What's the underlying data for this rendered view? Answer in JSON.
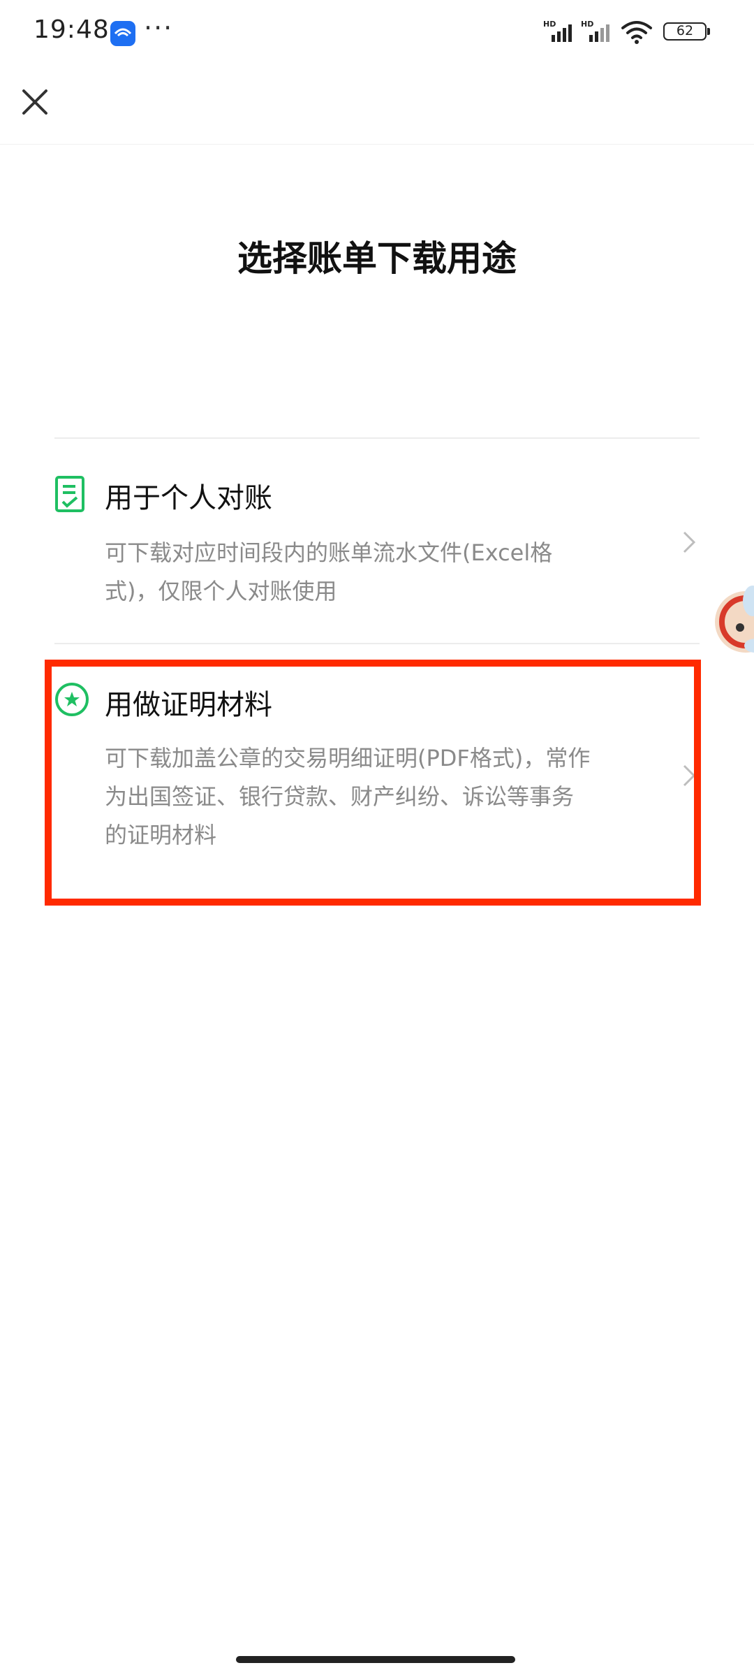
{
  "status_bar": {
    "time": "19:48",
    "app_icon": "messenger-app-icon",
    "more": "···",
    "signal_1_label": "HD",
    "signal_2_label": "HD",
    "battery": "62"
  },
  "nav": {
    "close_icon": "close-icon"
  },
  "page": {
    "title": "选择账单下载用途"
  },
  "options": [
    {
      "icon": "checklist-document-icon",
      "title": "用于个人对账",
      "desc_line1": "可下载对应时间段内的账单流水文件(Excel格",
      "desc_line2": "式)，仅限个人对账使用",
      "chevron": "chevron-right-icon"
    },
    {
      "icon": "star-circle-icon",
      "title": "用做证明材料",
      "desc_line1": "可下载加盖公章的交易明细证明(PDF格式)，常作",
      "desc_line2": "为出国签证、银行贷款、财产纠纷、诉讼等事务",
      "desc_line3": "的证明材料",
      "chevron": "chevron-right-icon"
    }
  ],
  "colors": {
    "accent_green": "#1fbf62",
    "highlight_red": "#ff2a00",
    "desc_gray": "#8a8a8a"
  }
}
